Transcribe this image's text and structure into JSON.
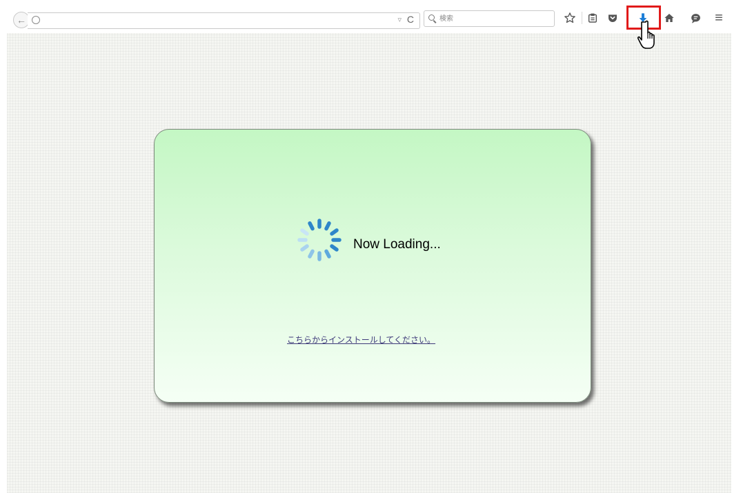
{
  "toolbar": {
    "search_placeholder": "検索",
    "dropmarker": "▿",
    "reload": "C",
    "menu_glyph": "≡"
  },
  "icons": {
    "back": "back-arrow-icon",
    "site": "site-info-icon",
    "bookmark": "star-icon",
    "bookmarks_list": "clipboard-icon",
    "pocket": "pocket-icon",
    "downloads": "download-arrow-icon",
    "home": "home-icon",
    "chat": "chat-bubble-icon",
    "menu": "hamburger-menu-icon"
  },
  "colors": {
    "highlight": "#e11a1a",
    "download_arrow": "#1e7fd8",
    "card_top": "#c4f7c4",
    "card_bottom": "#f5fff5",
    "spinner_dark": "#2e86c9",
    "spinner_light": "#a9d3ef"
  },
  "content": {
    "loading_text": "Now Loading...",
    "install_link": "こちらからインストールしてください。"
  }
}
